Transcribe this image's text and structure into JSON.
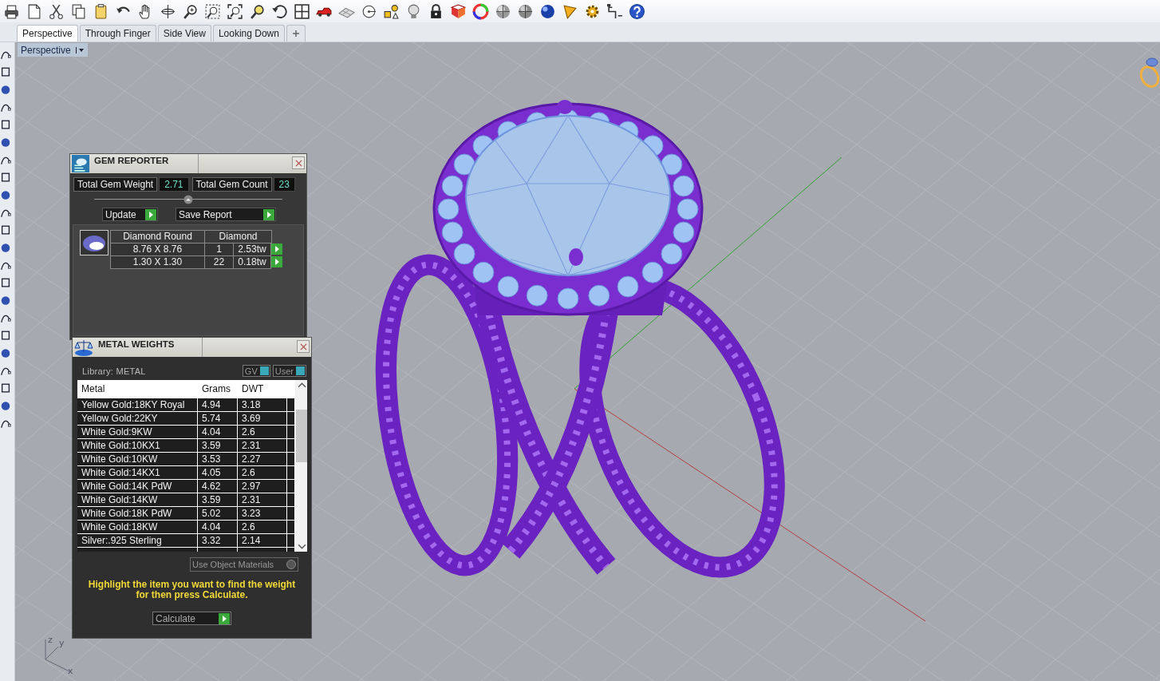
{
  "viewport_tabs": [
    {
      "label": "Perspective",
      "selected": true
    },
    {
      "label": "Through Finger",
      "selected": false
    },
    {
      "label": "Side View",
      "selected": false
    },
    {
      "label": "Looking Down",
      "selected": false
    }
  ],
  "viewport": {
    "label": "Perspective"
  },
  "gem_reporter": {
    "title": "GEM REPORTER",
    "totals": [
      {
        "label": "Total Gem Weight",
        "value": "2.71"
      },
      {
        "label": "Total Gem Count",
        "value": "23"
      }
    ],
    "buttons": [
      "Update",
      "Save Report"
    ],
    "table": {
      "shape": "Diamond Round",
      "material": "Diamond",
      "rows": [
        {
          "size": "8.76 X 8.76",
          "count": "1",
          "weight": "2.53tw"
        },
        {
          "size": "1.30 X 1.30",
          "count": "22",
          "weight": "0.18tw"
        }
      ]
    }
  },
  "metal_weights": {
    "title": "METAL WEIGHTS",
    "library": "Library: METAL",
    "toggles": [
      "GV",
      "User"
    ],
    "columns": [
      "Metal",
      "Grams",
      "DWT"
    ],
    "rows": [
      {
        "metal": "Yellow Gold:18KY Royal",
        "grams": "4.94",
        "dwt": "3.18"
      },
      {
        "metal": "Yellow Gold:22KY",
        "grams": "5.74",
        "dwt": "3.69"
      },
      {
        "metal": "White Gold:9KW",
        "grams": "4.04",
        "dwt": "2.6"
      },
      {
        "metal": "White Gold:10KX1",
        "grams": "3.59",
        "dwt": "2.31"
      },
      {
        "metal": "White Gold:10KW",
        "grams": "3.53",
        "dwt": "2.27"
      },
      {
        "metal": "White Gold:14KX1",
        "grams": "4.05",
        "dwt": "2.6"
      },
      {
        "metal": "White Gold:14K PdW",
        "grams": "4.62",
        "dwt": "2.97"
      },
      {
        "metal": "White Gold:14KW",
        "grams": "3.59",
        "dwt": "2.31"
      },
      {
        "metal": "White Gold:18K PdW",
        "grams": "5.02",
        "dwt": "3.23"
      },
      {
        "metal": "White Gold:18KW",
        "grams": "4.04",
        "dwt": "2.6"
      },
      {
        "metal": "Silver:.925 Sterling",
        "grams": "3.32",
        "dwt": "2.14"
      }
    ],
    "use_object_materials": {
      "label": "Use Object Materials",
      "checked": false
    },
    "hint": "Highlight the item you want to find the weight for then press Calculate.",
    "button": "Calculate"
  },
  "axis_labels": [
    "z",
    "y",
    "x"
  ]
}
